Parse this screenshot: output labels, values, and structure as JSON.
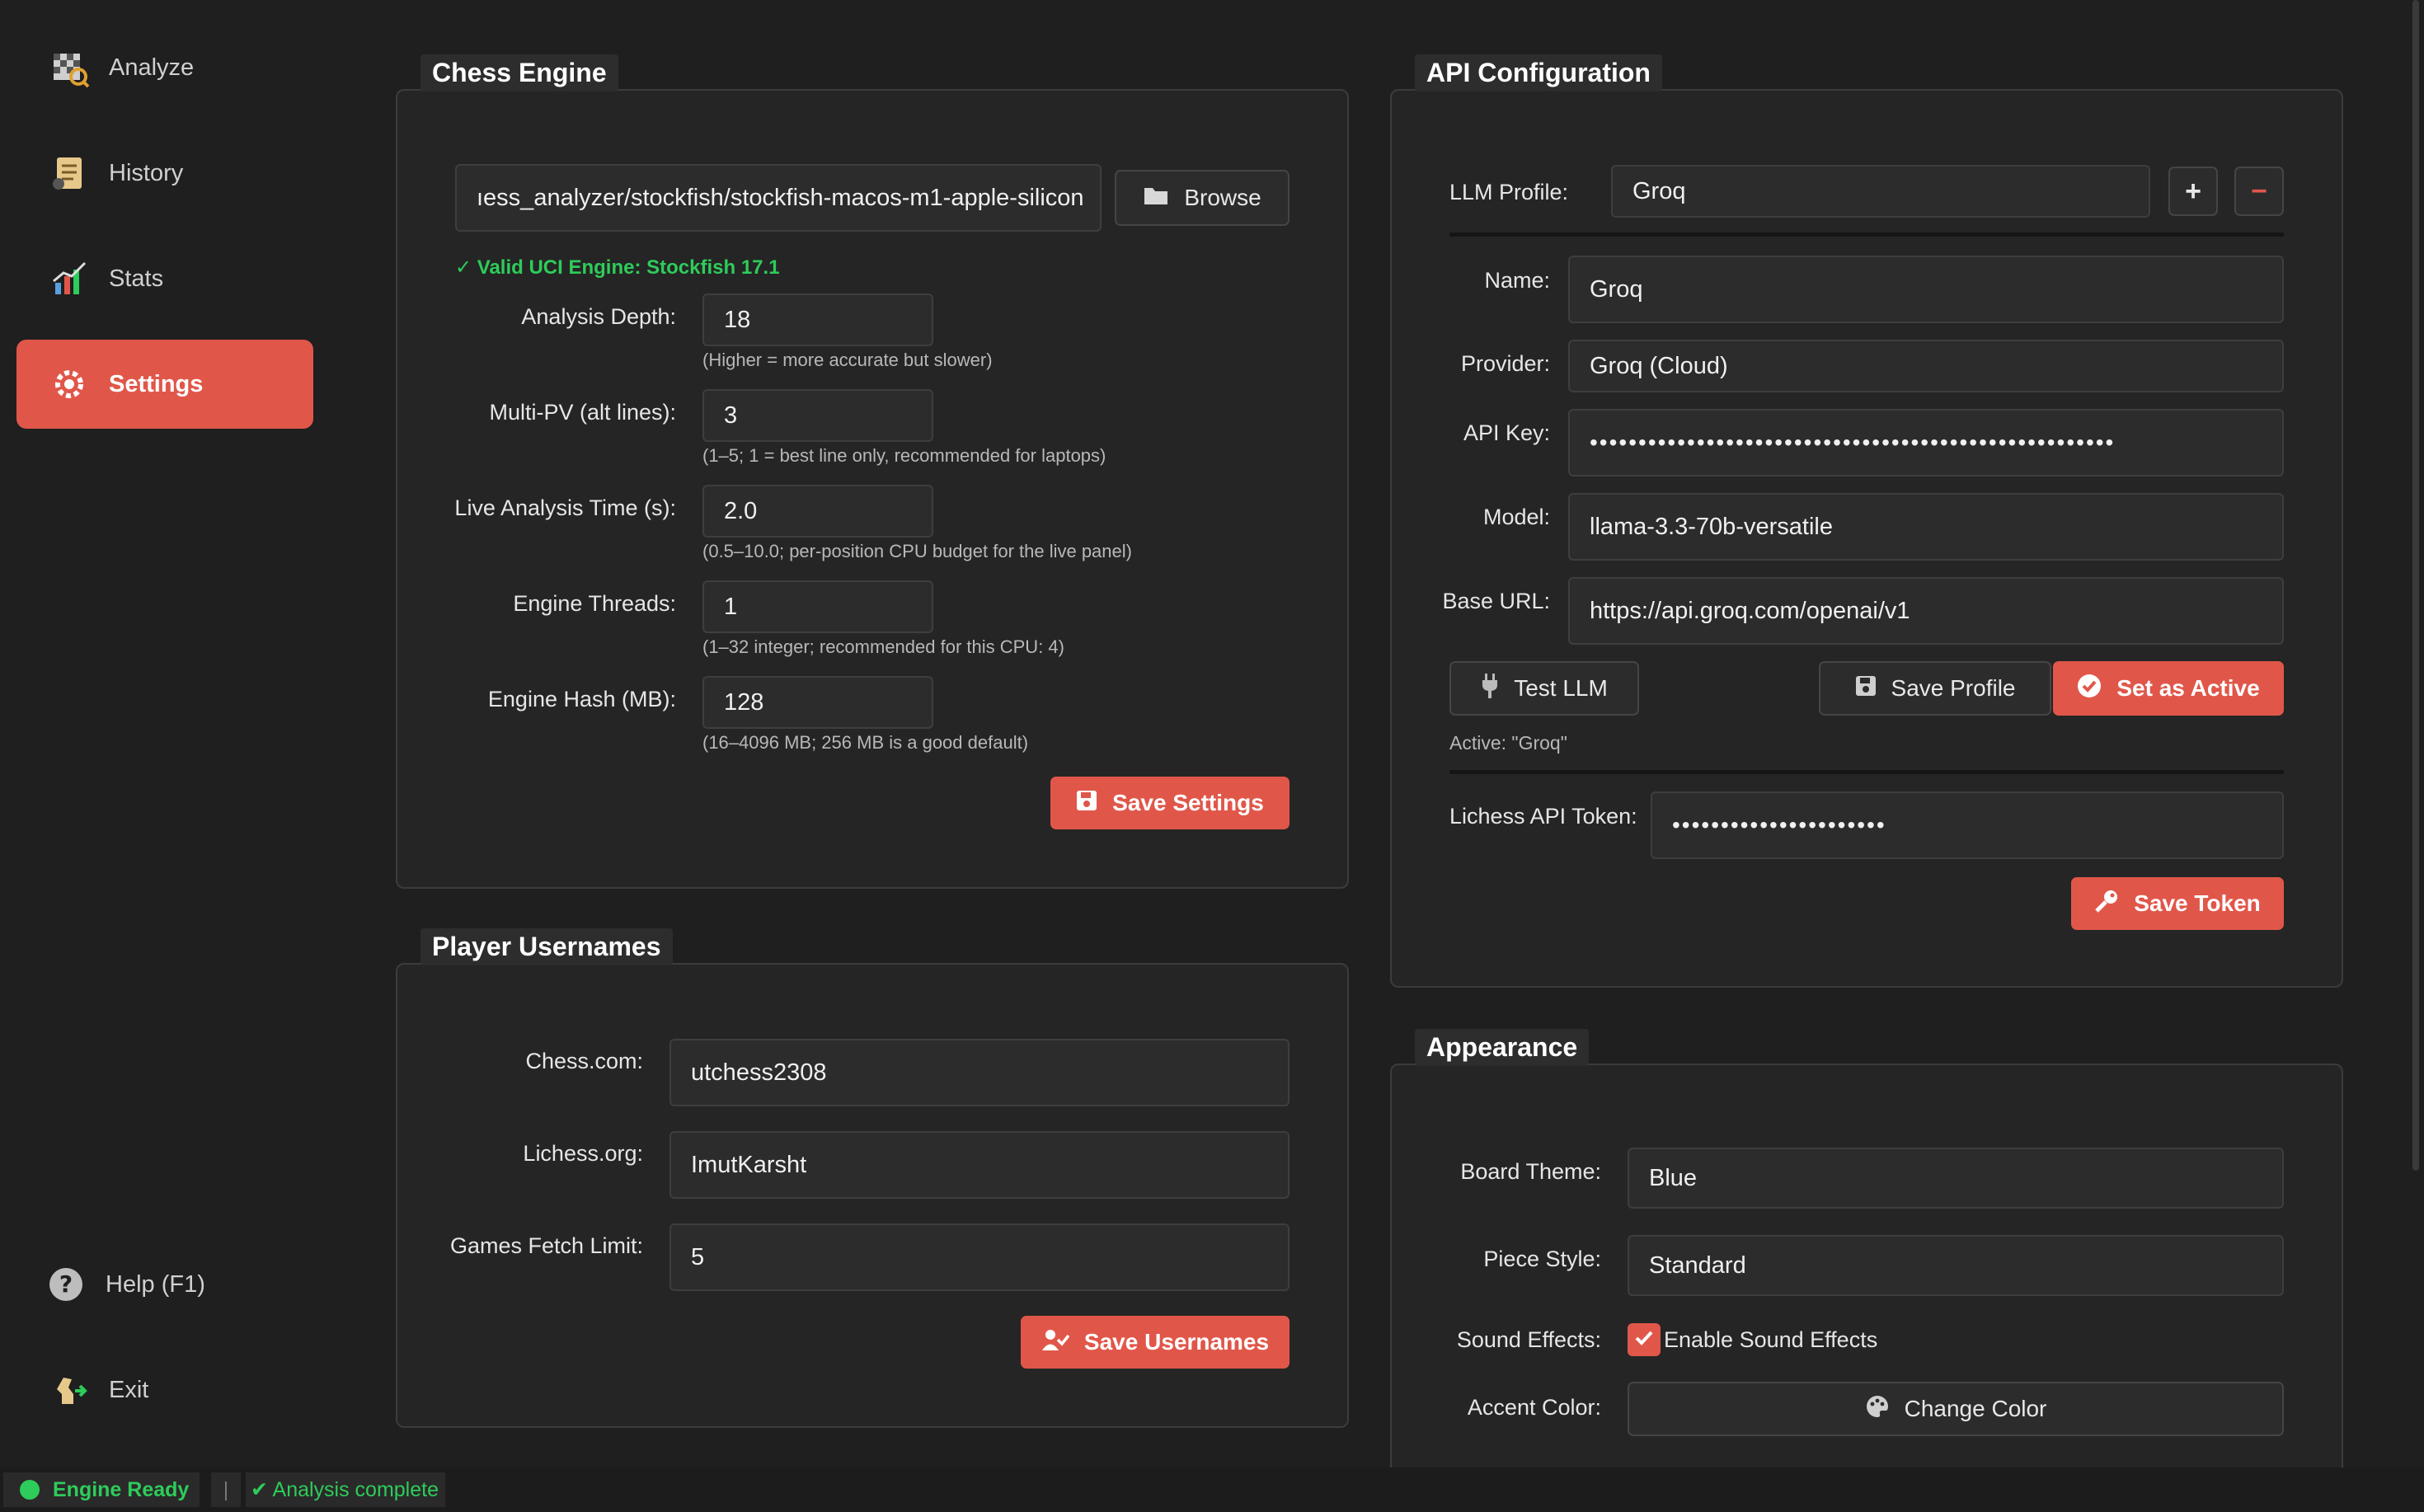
{
  "sidebar": {
    "items": [
      {
        "label": "Analyze",
        "icon": "board-analyze-icon"
      },
      {
        "label": "History",
        "icon": "scroll-history-icon"
      },
      {
        "label": "Stats",
        "icon": "chart-stats-icon"
      },
      {
        "label": "Settings",
        "icon": "gear-settings-icon",
        "active": true
      }
    ],
    "help_label": "Help (F1)",
    "exit_label": "Exit"
  },
  "engine": {
    "title": "Chess Engine",
    "path": "ıess_analyzer/stockfish/stockfish-macos-m1-apple-silicon",
    "browse_label": "Browse",
    "valid_text": "✓ Valid UCI Engine: Stockfish 17.1",
    "fields": [
      {
        "label": "Analysis Depth:",
        "value": "18",
        "hint": "(Higher = more accurate but slower)"
      },
      {
        "label": "Multi-PV (alt lines):",
        "value": "3",
        "hint": "(1–5; 1 = best line only, recommended for laptops)"
      },
      {
        "label": "Live Analysis Time (s):",
        "value": "2.0",
        "hint": "(0.5–10.0; per-position CPU budget for the live panel)"
      },
      {
        "label": "Engine Threads:",
        "value": "1",
        "hint": "(1–32 integer; recommended for this CPU: 4)"
      },
      {
        "label": "Engine Hash (MB):",
        "value": "128",
        "hint": "(16–4096 MB; 256 MB is a good default)"
      }
    ],
    "save_label": "Save Settings"
  },
  "usernames": {
    "title": "Player Usernames",
    "fields": [
      {
        "label": "Chess.com:",
        "value": "utchess2308"
      },
      {
        "label": "Lichess.org:",
        "value": "ImutKarsht"
      },
      {
        "label": "Games Fetch Limit:",
        "value": "5"
      }
    ],
    "save_label": "Save Usernames"
  },
  "api": {
    "title": "API Configuration",
    "profile_label": "LLM Profile:",
    "profile_value": "Groq",
    "add_label": "+",
    "remove_label": "−",
    "name_label": "Name:",
    "name_value": "Groq",
    "provider_label": "Provider:",
    "provider_value": "Groq (Cloud)",
    "key_label": "API Key:",
    "key_value": "••••••••••••••••••••••••••••••••••••••••••••••••••••••",
    "model_label": "Model:",
    "model_value": "llama-3.3-70b-versatile",
    "url_label": "Base URL:",
    "url_value": "https://api.groq.com/openai/v1",
    "test_label": "Test LLM",
    "save_profile_label": "Save Profile",
    "set_active_label": "Set as Active",
    "active_text": "Active: \"Groq\"",
    "token_label": "Lichess API Token:",
    "token_value": "••••••••••••••••••••••",
    "save_token_label": "Save Token"
  },
  "appearance": {
    "title": "Appearance",
    "theme_label": "Board Theme:",
    "theme_value": "Blue",
    "piece_label": "Piece Style:",
    "piece_value": "Standard",
    "sound_label": "Sound Effects:",
    "sound_checkbox_label": "Enable Sound Effects",
    "sound_checked": true,
    "accent_label": "Accent Color:",
    "accent_button_label": "Change Color"
  },
  "status": {
    "engine": "Engine Ready",
    "analysis": "✔ Analysis complete"
  },
  "colors": {
    "accent": "#e0574a",
    "success": "#2ecc5a",
    "background": "#1f1f1f"
  }
}
